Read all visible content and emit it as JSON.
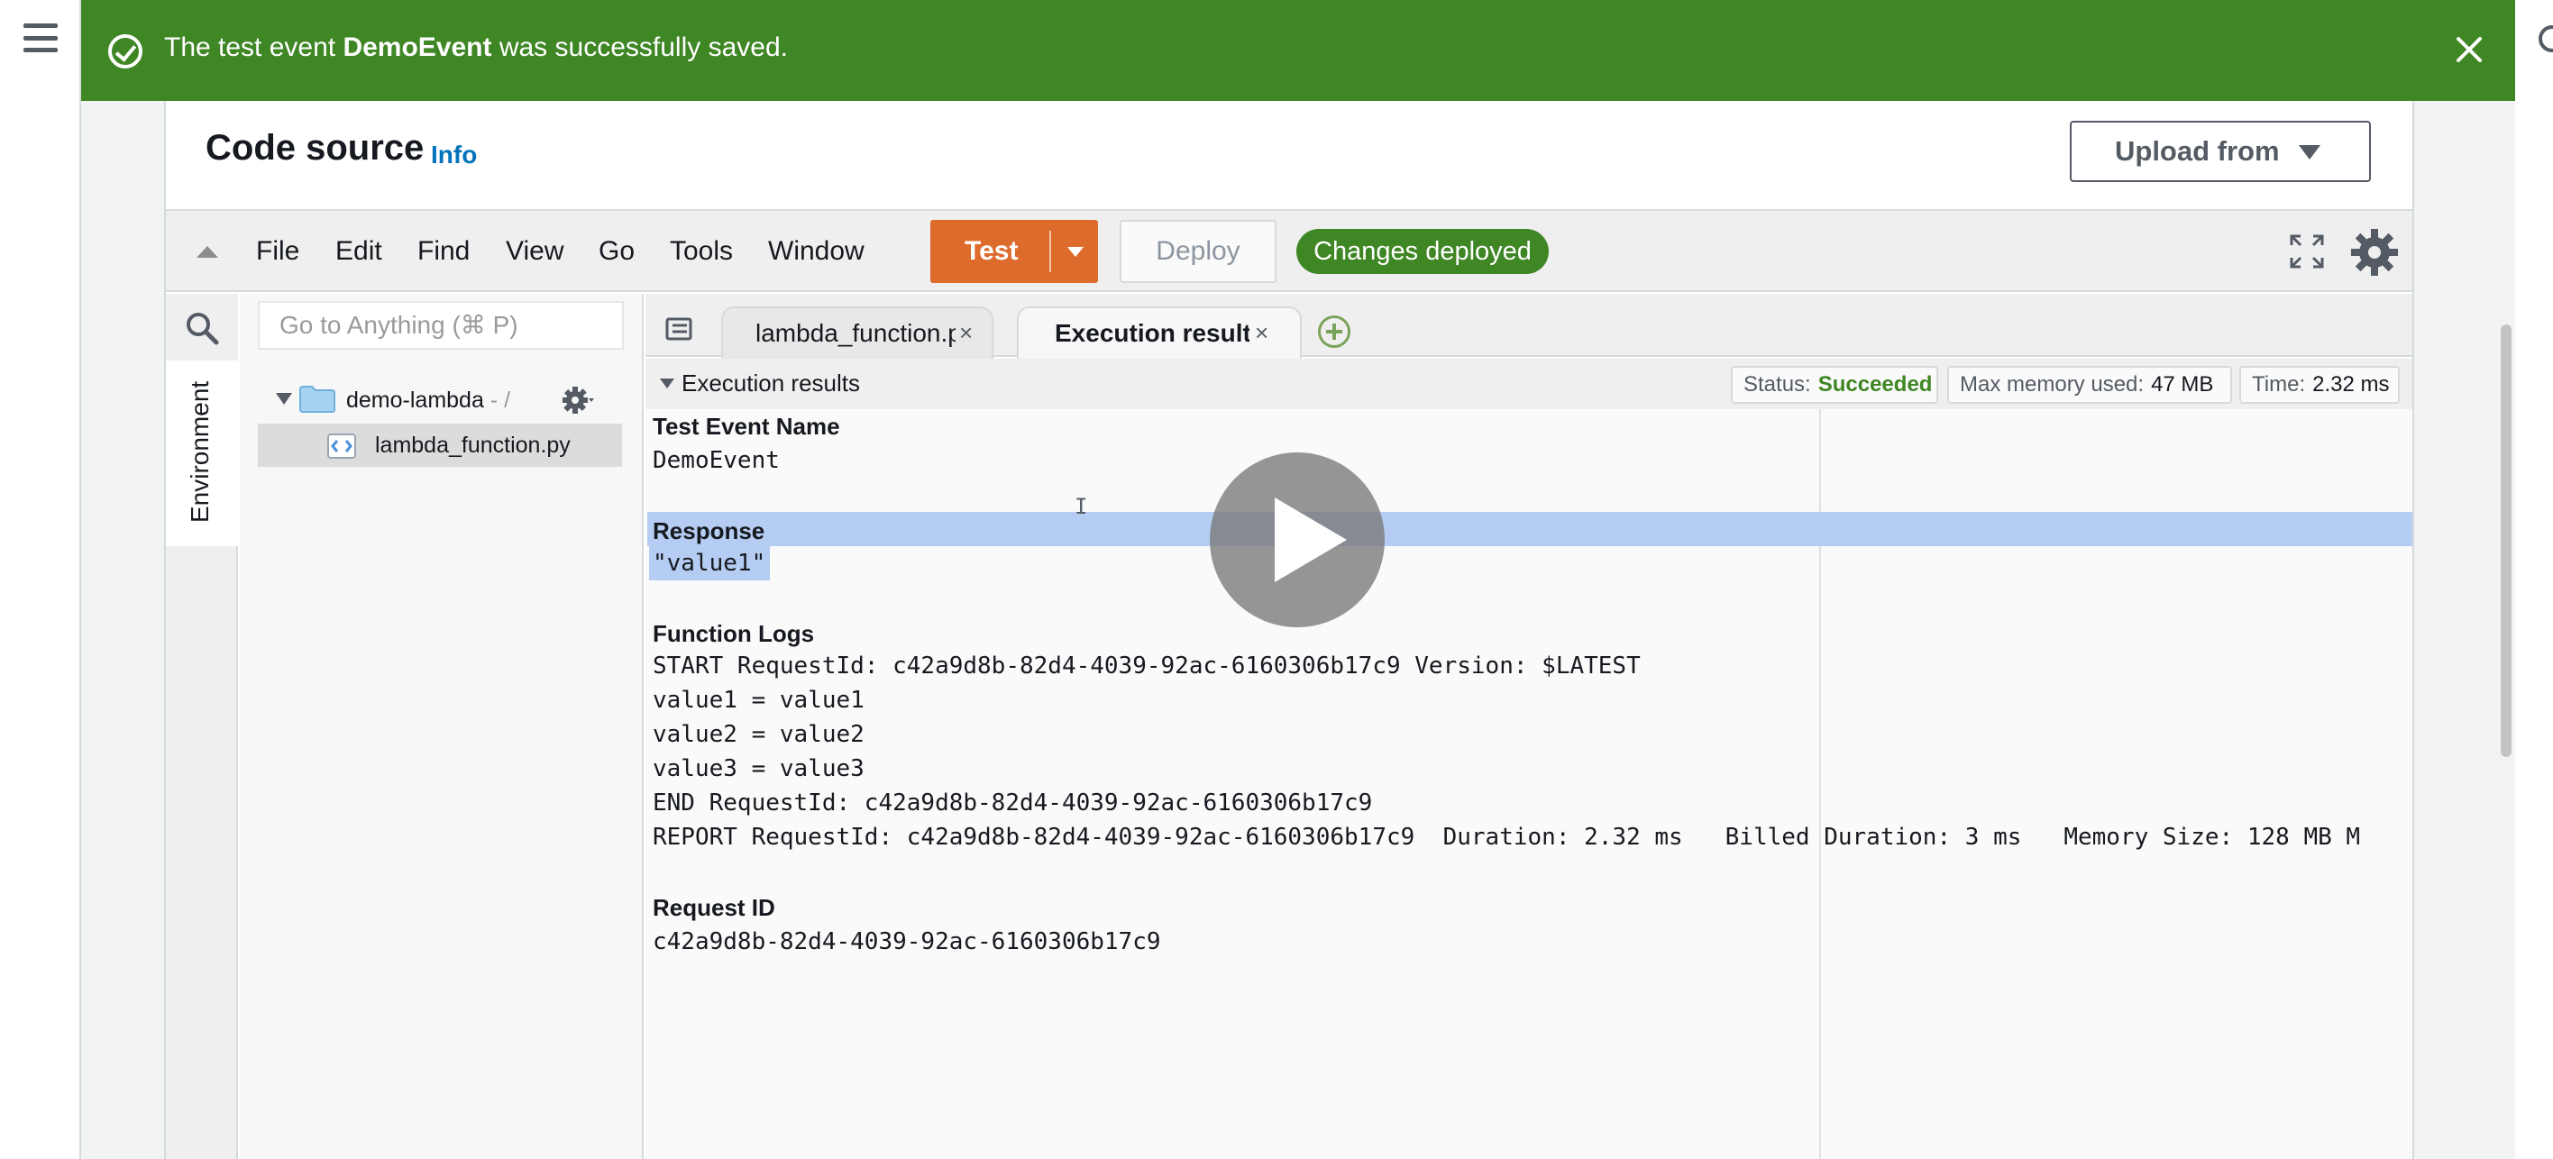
{
  "flash": {
    "prefix": "The test event ",
    "event_name": "DemoEvent",
    "suffix": " was successfully saved."
  },
  "panel": {
    "title": "Code source",
    "info": "Info",
    "upload_button": "Upload from"
  },
  "toolbar": {
    "menus": [
      "File",
      "Edit",
      "Find",
      "View",
      "Go",
      "Tools",
      "Window"
    ],
    "test_label": "Test",
    "deploy_label": "Deploy",
    "status_badge": "Changes deployed"
  },
  "sidebar": {
    "env_tab": "Environment",
    "search_placeholder": "Go to Anything (⌘ P)",
    "folder": "demo-lambda",
    "folder_suffix": " - /",
    "file": "lambda_function.py"
  },
  "tabs": [
    {
      "label": "lambda_function.py"
    },
    {
      "label": "Execution results"
    }
  ],
  "exec": {
    "header": "Execution results",
    "status_label": "Status:",
    "status_value": "Succeeded",
    "memory_label": "Max memory used:",
    "memory_value": "47 MB",
    "time_label": "Time:",
    "time_value": "2.32 ms",
    "test_event_title": "Test Event Name",
    "test_event_value": "DemoEvent",
    "response_title": "Response",
    "response_value": "\"value1\"",
    "logs_title": "Function Logs",
    "logs": [
      "START RequestId: c42a9d8b-82d4-4039-92ac-6160306b17c9 Version: $LATEST",
      "value1 = value1",
      "value2 = value2",
      "value3 = value3",
      "END RequestId: c42a9d8b-82d4-4039-92ac-6160306b17c9",
      "REPORT RequestId: c42a9d8b-82d4-4039-92ac-6160306b17c9  Duration: 2.32 ms   Billed Duration: 3 ms   Memory Size: 128 MB M"
    ],
    "request_id_title": "Request ID",
    "request_id_value": "c42a9d8b-82d4-4039-92ac-6160306b17c9"
  },
  "colors": {
    "flash_green": "#3f8624",
    "test_orange": "#dd6b2c",
    "link_blue": "#0073bb",
    "selection": "#b5cdf2"
  }
}
